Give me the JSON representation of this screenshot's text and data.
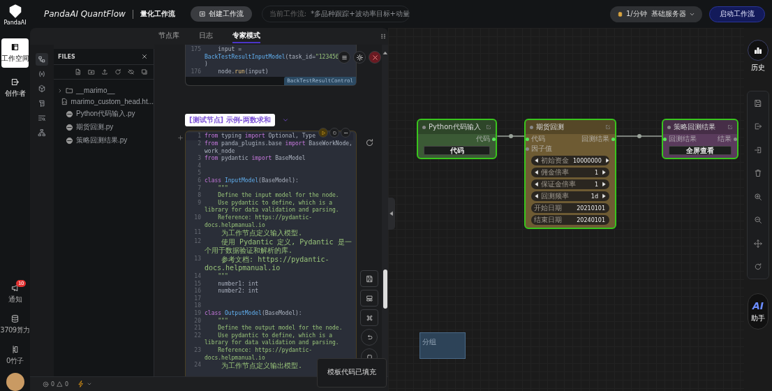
{
  "rail": {
    "logo": "PandaAI",
    "nav": [
      {
        "kind": "workspace",
        "label": "工作空间",
        "selected": true
      },
      {
        "kind": "creator",
        "label": "创作者",
        "selected": false
      }
    ],
    "bottom": [
      {
        "kind": "notify",
        "label": "通知",
        "badge": "10"
      },
      {
        "kind": "compute",
        "label": "3709算力"
      },
      {
        "kind": "bamboo",
        "label": "0竹子"
      }
    ]
  },
  "header": {
    "brand": "PandaAI QuantFlow",
    "subtitle": "量化工作流",
    "create_button": "创建工作流",
    "current_label": "当前工作流:",
    "current_value": "*多品种跟踪+波动率目标+动量",
    "server": "1/分钟  基础服务器",
    "start_button": "启动工作流"
  },
  "panel_tabs": [
    {
      "label": "节点库",
      "selected": false
    },
    {
      "label": "日志",
      "selected": false
    },
    {
      "label": "专家模式",
      "selected": true
    }
  ],
  "activity_bar": [
    {
      "kind": "explorer",
      "selected": true
    },
    {
      "kind": "variables",
      "selected": false
    },
    {
      "kind": "cube",
      "selected": false
    },
    {
      "kind": "scroll",
      "selected": false
    },
    {
      "kind": "search-list",
      "selected": false
    },
    {
      "kind": "tree",
      "selected": false
    }
  ],
  "files": {
    "title": "FILES",
    "tree": [
      {
        "kind": "folder",
        "name": "__marimo__",
        "expanded": false
      },
      {
        "kind": "html",
        "name": "marimo_custom_head.ht..."
      },
      {
        "kind": "python",
        "name": "Python代码输入.py"
      },
      {
        "kind": "python",
        "name": "期货回测.py"
      },
      {
        "kind": "python",
        "name": "策略回测结果.py"
      }
    ]
  },
  "prev_cell": {
    "lines": [
      {
        "n": "175",
        "code": [
          {
            "kind": "plain",
            "text": "    input = "
          },
          {
            "kind": "class",
            "text": "BackTestResultInputModel"
          },
          {
            "kind": "plain",
            "text": "(task_id="
          },
          {
            "kind": "string",
            "text": "\"123456"
          }
        ]
      },
      {
        "code": [
          {
            "kind": "plain",
            "text": ")"
          }
        ]
      },
      {
        "n": "176",
        "code": [
          {
            "kind": "plain",
            "text": "    node."
          },
          {
            "kind": "function",
            "text": "run"
          },
          {
            "kind": "plain",
            "text": "(input)"
          }
        ]
      }
    ],
    "tag": "BackTestResultControl"
  },
  "cell": {
    "title": "[测试节点] 示例-两数求和",
    "lines": [
      {
        "n": "1",
        "code": [
          {
            "kind": "keyword",
            "text": "from"
          },
          {
            "kind": "plain",
            "text": " typing "
          },
          {
            "kind": "keyword",
            "text": "import"
          },
          {
            "kind": "plain",
            "text": " Optional, Type"
          }
        ]
      },
      {
        "n": "2",
        "code": [
          {
            "kind": "keyword",
            "text": "from"
          },
          {
            "kind": "plain",
            "text": " panda_plugins.base "
          },
          {
            "kind": "keyword",
            "text": "import"
          },
          {
            "kind": "plain",
            "text": " BaseWorkNode, work_node"
          }
        ]
      },
      {
        "n": "3",
        "code": [
          {
            "kind": "keyword",
            "text": "from"
          },
          {
            "kind": "plain",
            "text": " pydantic "
          },
          {
            "kind": "keyword",
            "text": "import"
          },
          {
            "kind": "plain",
            "text": " BaseModel"
          }
        ]
      },
      {
        "n": "4"
      },
      {
        "n": "5"
      },
      {
        "n": "6",
        "code": [
          {
            "kind": "keyword",
            "text": "class "
          },
          {
            "kind": "class",
            "text": "InputModel"
          },
          {
            "kind": "plain",
            "text": "(BaseModel):"
          }
        ]
      },
      {
        "n": "7",
        "code": [
          {
            "kind": "doc",
            "text": "    \"\"\""
          }
        ]
      },
      {
        "n": "8",
        "code": [
          {
            "kind": "doc",
            "text": "    Define the input model for the node."
          }
        ]
      },
      {
        "n": "9",
        "code": [
          {
            "kind": "doc",
            "text": "    Use pydantic to define, which is a library for data validation and parsing."
          }
        ]
      },
      {
        "n": "10",
        "code": [
          {
            "kind": "doc",
            "text": "    Reference: https://pydantic-docs.helpmanual.io"
          }
        ]
      },
      {
        "n": "11",
        "code": [
          {
            "kind": "doc-cjk",
            "text": "    为工作节点定义输入模型."
          }
        ]
      },
      {
        "n": "12",
        "code": [
          {
            "kind": "doc-cjk",
            "text": "    使用 Pydantic 定义, Pydantic 是一个用于数据验证和解析的库."
          }
        ]
      },
      {
        "n": "13",
        "code": [
          {
            "kind": "doc-cjk",
            "text": "    参考文档: https://pydantic-docs.helpmanual.io"
          }
        ]
      },
      {
        "n": "14",
        "code": [
          {
            "kind": "doc",
            "text": "    \"\"\""
          }
        ]
      },
      {
        "n": "15",
        "code": [
          {
            "kind": "plain",
            "text": "    number1: int"
          }
        ]
      },
      {
        "n": "16",
        "code": [
          {
            "kind": "plain",
            "text": "    number2: int"
          }
        ]
      },
      {
        "n": "17"
      },
      {
        "n": "18"
      },
      {
        "n": "19",
        "code": [
          {
            "kind": "keyword",
            "text": "class "
          },
          {
            "kind": "class",
            "text": "OutputModel"
          },
          {
            "kind": "plain",
            "text": "(BaseModel):"
          }
        ]
      },
      {
        "n": "20",
        "code": [
          {
            "kind": "doc",
            "text": "    \"\"\""
          }
        ]
      },
      {
        "n": "21",
        "code": [
          {
            "kind": "doc",
            "text": "    Define the output model for the node."
          }
        ]
      },
      {
        "n": "22",
        "code": [
          {
            "kind": "doc",
            "text": "    Use pydantic to define, which is a library for data validation and parsing."
          }
        ]
      },
      {
        "n": "23",
        "code": [
          {
            "kind": "doc",
            "text": "    Reference: https://pydantic-docs.helpmanual.io"
          }
        ]
      },
      {
        "n": "24",
        "code": [
          {
            "kind": "doc-cjk",
            "text": "    为工作节点定义输出模型."
          }
        ]
      }
    ]
  },
  "toast": "模板代码已填充",
  "status_bar": {
    "errors": "0",
    "warnings": "0"
  },
  "canvas": {
    "nodes": [
      {
        "title": "Python代码输入",
        "color": "#3b5a35",
        "selected": true,
        "outputs": [
          {
            "label": "代码",
            "connected": true
          }
        ],
        "button": "代码"
      },
      {
        "title": "期货回测",
        "color": "#6e5b33",
        "selected": true,
        "inputs": [
          {
            "label": "代码",
            "connected": true
          },
          {
            "label": "因子值",
            "connected": false
          }
        ],
        "outputs": [
          {
            "label": "回测结果",
            "connected": true
          }
        ],
        "params": [
          {
            "kind": "stepper",
            "label": "初始资金",
            "value": "10000000"
          },
          {
            "kind": "stepper",
            "label": "佣金倍率",
            "value": "1"
          },
          {
            "kind": "stepper",
            "label": "保证金倍率",
            "value": "1"
          },
          {
            "kind": "stepper",
            "label": "回测频率",
            "value": "1d"
          },
          {
            "kind": "text",
            "label": "开始日期",
            "value": "20210101"
          },
          {
            "kind": "text",
            "label": "结束日期",
            "value": "20240101"
          }
        ]
      },
      {
        "title": "策略回测结果",
        "color": "#5a3b5c",
        "selected": true,
        "inputs": [
          {
            "label": "回测结果",
            "connected": true
          }
        ],
        "outputs": [
          {
            "label": "结果",
            "connected": false
          }
        ],
        "button": "全屏查看"
      }
    ],
    "group": "分组"
  },
  "right_bar": {
    "history": "历史",
    "assistant_icon": "AI",
    "assistant": "助手"
  }
}
